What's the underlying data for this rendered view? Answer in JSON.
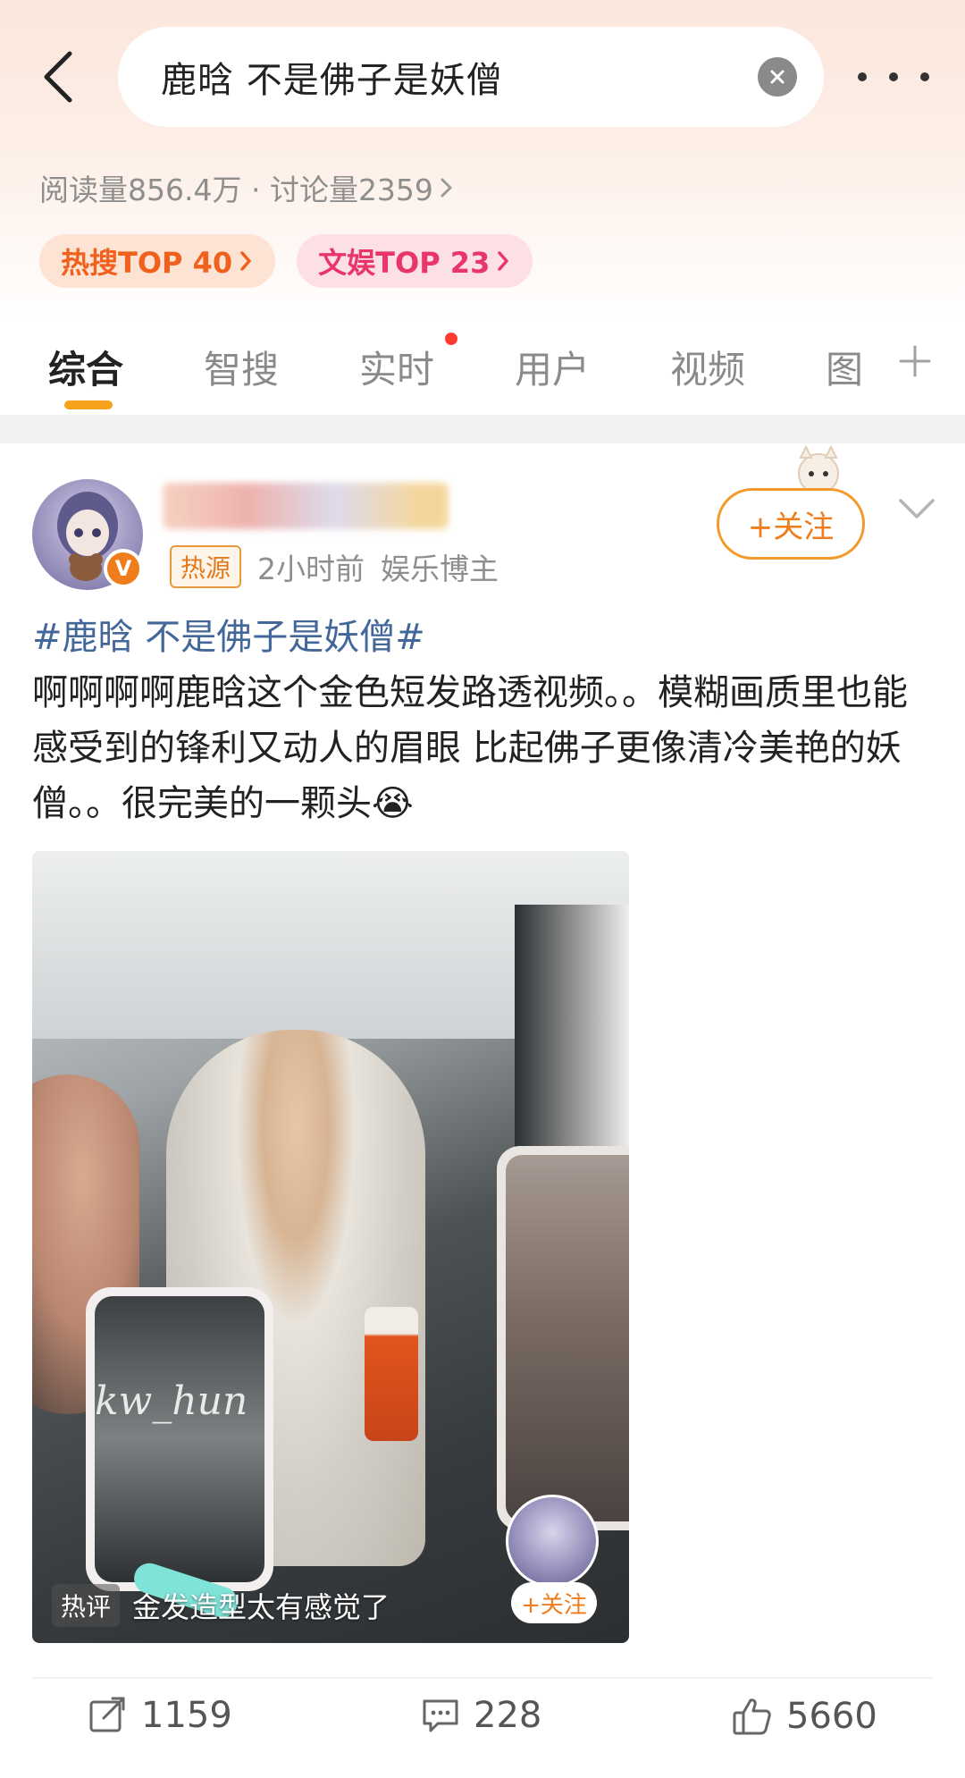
{
  "header": {
    "search_query": "鹿晗 不是佛子是妖僧"
  },
  "stats": {
    "text": "阅读量856.4万 · 讨论量2359"
  },
  "ranks": [
    {
      "label": "热搜TOP 40"
    },
    {
      "label": "文娱TOP 23"
    }
  ],
  "tabs": [
    {
      "label": "综合"
    },
    {
      "label": "智搜"
    },
    {
      "label": "实时"
    },
    {
      "label": "用户"
    },
    {
      "label": "视频"
    },
    {
      "label": "图"
    }
  ],
  "post": {
    "source_tag": "热源",
    "time": "2小时前",
    "role": "娱乐博主",
    "follow_label": "+关注",
    "hashtag": "#鹿晗 不是佛子是妖僧#",
    "body": "啊啊啊啊鹿晗这个金色短发路透视频。。模糊画质里也能感受到的锋利又动人的眉眼 比起佛子更像清冷美艳的妖僧。。很完美的一颗头😭",
    "media": {
      "watermark": "kw_hun",
      "hot_tag": "热评",
      "hot_comment": "金发造型太有感觉了",
      "mini_follow": "+关注"
    }
  },
  "actions": {
    "repost_count": "1159",
    "comment_count": "228",
    "like_count": "5660"
  },
  "colors": {
    "accent_orange": "#f07d1b",
    "hashtag_blue": "#44679a",
    "tab_indicator": "#f7a21d",
    "badge_red": "#ff3b30"
  }
}
